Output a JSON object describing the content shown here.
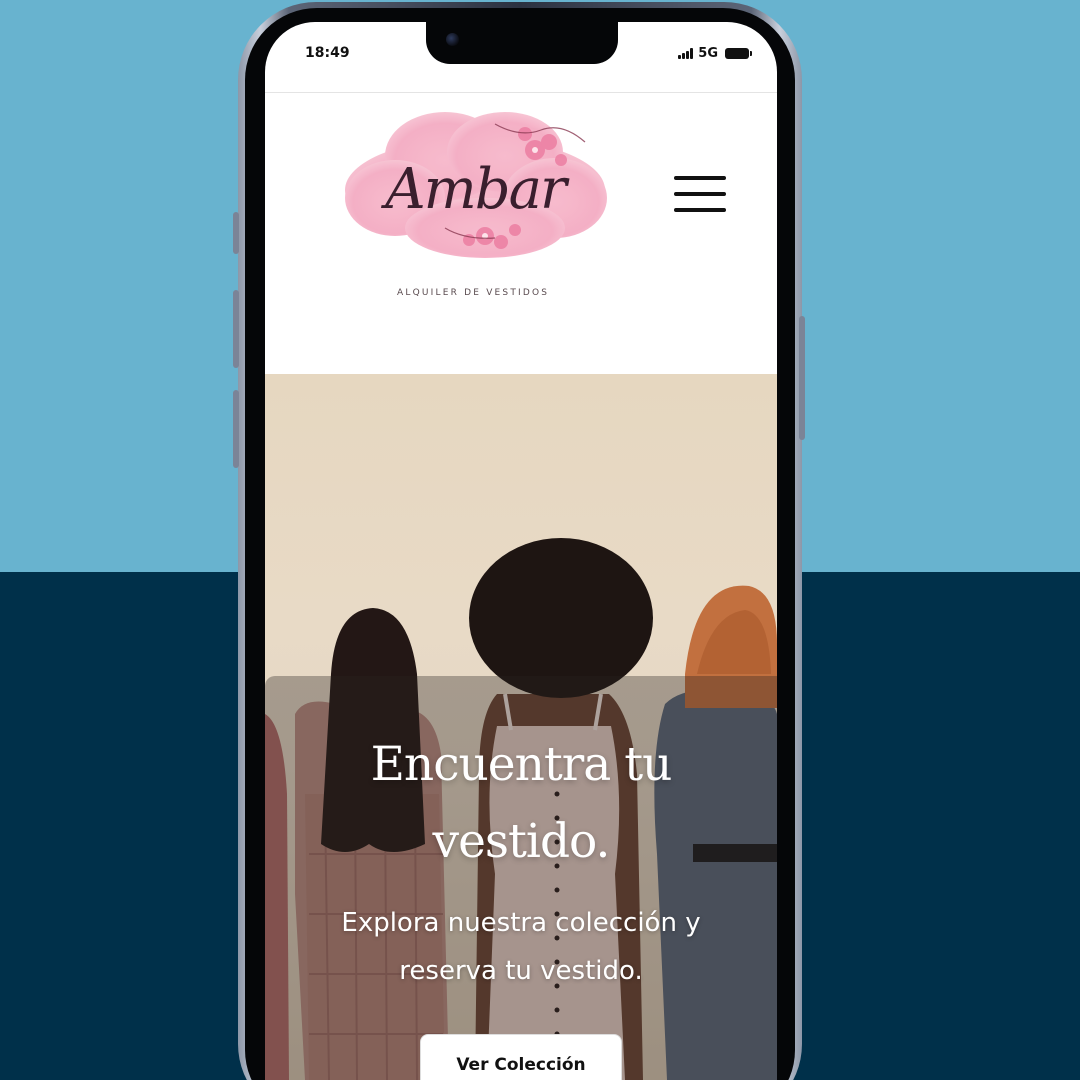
{
  "status_bar": {
    "time": "18:49",
    "network": "5G",
    "icons": [
      "signal-icon",
      "battery-icon"
    ]
  },
  "brand": {
    "logo_text": "Ambar",
    "tagline": "ALQUILER DE VESTIDOS"
  },
  "header": {
    "menu_icon": "hamburger-menu-icon"
  },
  "hero": {
    "title": "Encuentra tu vestido.",
    "subtitle": "Explora nuestra colección y reserva tu vestido.",
    "cta_label": "Ver Colección"
  },
  "colors": {
    "background_top": "#68b3cf",
    "background_bottom": "#00304a",
    "logo_pink": "#f4a9c1",
    "logo_text": "#3a1f2e",
    "hero_bg": "#e6d7c0"
  }
}
